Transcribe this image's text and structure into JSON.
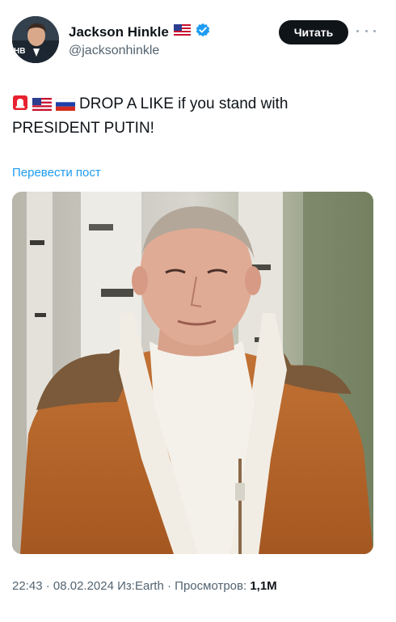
{
  "author": {
    "display_name": "Jackson Hinkle",
    "handle": "@jacksonhinkle",
    "verified": true,
    "avatar_badge": "HB"
  },
  "header": {
    "follow_label": "Читать",
    "more_icon": "more-icon"
  },
  "tweet": {
    "emoji_icons": [
      "rotating-light-emoji",
      "us-flag-emoji",
      "russia-flag-emoji"
    ],
    "text_line1": "DROP A LIKE if you stand with",
    "text_line2": "PRESIDENT PUTIN!",
    "translate_label": "Перевести пост"
  },
  "meta": {
    "time": "22:43",
    "sep1": " · ",
    "date": "08.02.2024",
    "source_prefix": " Из:",
    "source": "Earth",
    "sep2": " · ",
    "views_label": "Просмотров: ",
    "views_count": "1,1M"
  },
  "colors": {
    "link": "#1d9bf0",
    "verified": "#1d9bf0",
    "text": "#0f1419",
    "muted": "#536471",
    "follow_bg": "#0f1419"
  }
}
